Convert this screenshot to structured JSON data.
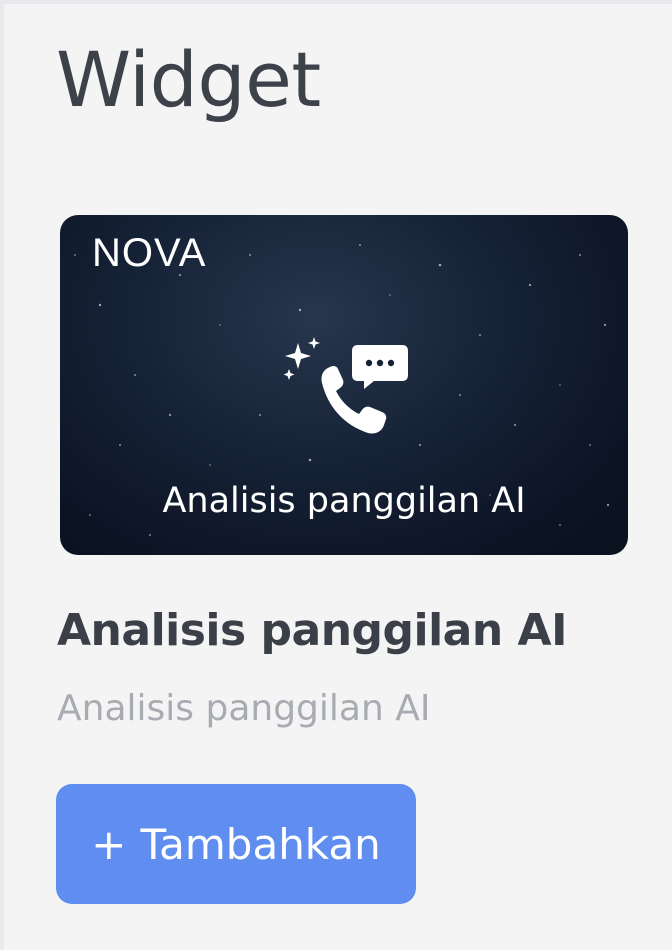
{
  "page": {
    "title": "Widget"
  },
  "widget": {
    "thumbnail": {
      "brand": "NOVA",
      "caption": "Analisis panggilan AI",
      "icon": "sparkle-phone-chat-icon"
    },
    "name": "Analisis panggilan AI",
    "description": "Analisis panggilan AI",
    "add_button": {
      "icon": "+",
      "label": "Tambahkan"
    }
  },
  "colors": {
    "background": "#f4f4f5",
    "title_text": "#3d4149",
    "description_text": "#a8abb1",
    "button_bg": "#5f8df0",
    "card_bg": "#152135"
  }
}
